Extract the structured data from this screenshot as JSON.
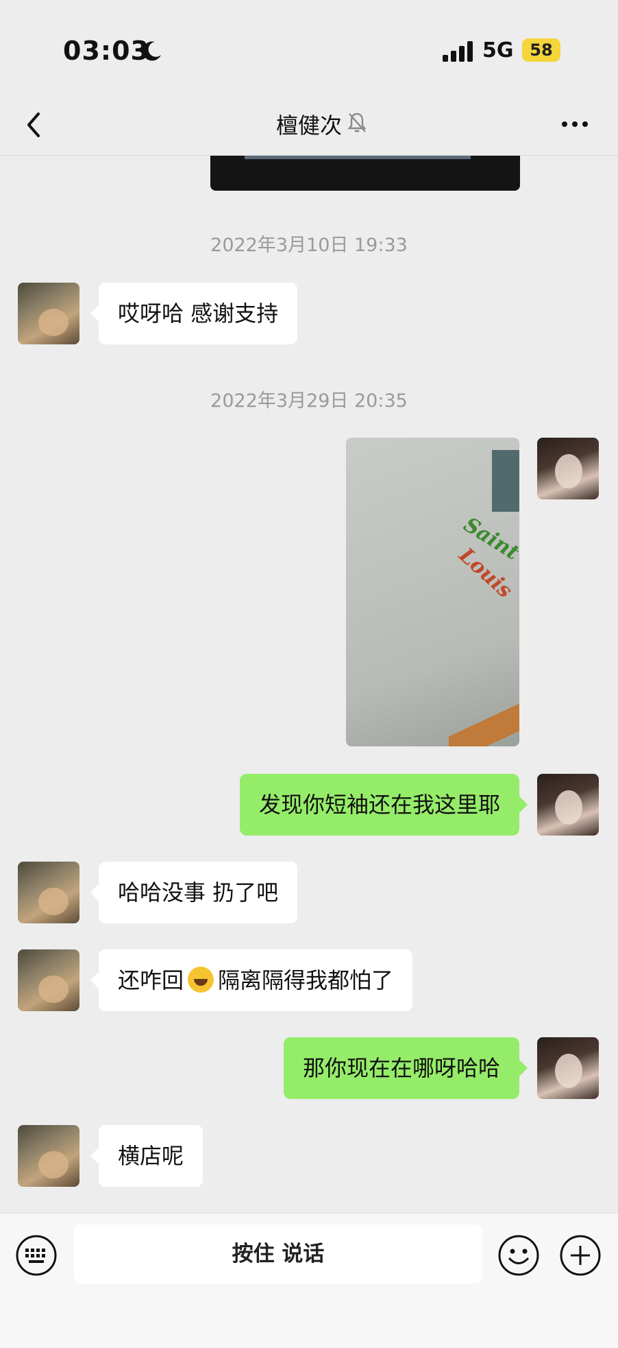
{
  "status_bar": {
    "time": "03:03",
    "network": "5G",
    "battery": "58"
  },
  "header": {
    "title": "檀健次"
  },
  "messages": [
    {
      "type": "timestamp",
      "text": "2022年3月10日 19:33"
    },
    {
      "type": "text",
      "side": "left",
      "text": "哎呀哈 感谢支持"
    },
    {
      "type": "timestamp",
      "text": "2022年3月29日 20:35"
    },
    {
      "type": "image",
      "side": "right",
      "image_text": [
        "Saint",
        "Louis"
      ]
    },
    {
      "type": "text",
      "side": "right",
      "text": "发现你短袖还在我这里耶"
    },
    {
      "type": "text",
      "side": "left",
      "text": "哈哈没事 扔了吧"
    },
    {
      "type": "text",
      "side": "left",
      "text_before": "还咋回",
      "emoji": "laugh-cry-emoji",
      "text_after": "隔离隔得我都怕了"
    },
    {
      "type": "text",
      "side": "right",
      "text": "那你现在在哪呀哈哈"
    },
    {
      "type": "text",
      "side": "left",
      "text": "横店呢"
    }
  ],
  "input_bar": {
    "talk_label": "按住 说话"
  },
  "colors": {
    "background": "#ededed",
    "sent_bubble": "#95ec69",
    "received_bubble": "#ffffff",
    "battery": "#f6d53a"
  }
}
